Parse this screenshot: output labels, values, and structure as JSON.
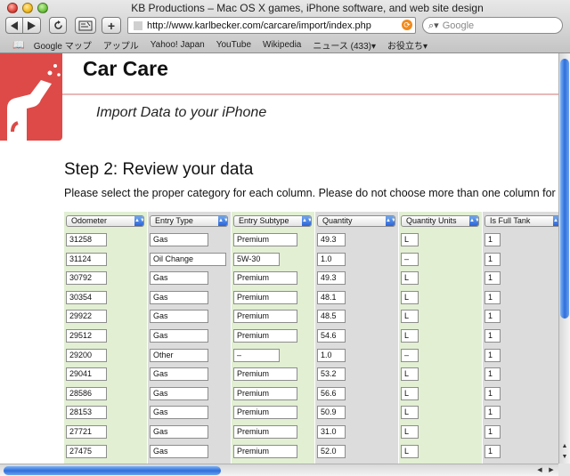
{
  "window": {
    "title": "KB Productions – Mac OS X games, iPhone software, and web site design"
  },
  "toolbar": {
    "back_icon": "back-arrow-icon",
    "forward_icon": "forward-arrow-icon",
    "reload_label": "c",
    "add_bookmark_label": "+",
    "url": "http://www.karlbecker.com/carcare/import/index.php",
    "search_placeholder": "Google"
  },
  "bookmarks": {
    "items": [
      "Google マップ",
      "アップル",
      "Yahoo! Japan",
      "YouTube",
      "Wikipedia",
      "ニュース (433)▾",
      "お役立ち▾"
    ]
  },
  "page": {
    "app_title": "Car Care",
    "app_subtitle": "Import Data to your iPhone",
    "step_title": "Step 2: Review your data",
    "instructions": "Please select the proper category for each column. Please do not choose more than one column for",
    "logo_color": "#dd4a47"
  },
  "grid": {
    "columns": [
      "Odometer",
      "Entry Type",
      "Entry Subtype",
      "Quantity",
      "Quantity Units",
      "Is Full Tank"
    ],
    "rows": [
      [
        "31258",
        "Gas",
        "Premium",
        "49.3",
        "L",
        "1"
      ],
      [
        "31124",
        "Oil Change",
        "5W-30",
        "1.0",
        "–",
        "1"
      ],
      [
        "30792",
        "Gas",
        "Premium",
        "49.3",
        "L",
        "1"
      ],
      [
        "30354",
        "Gas",
        "Premium",
        "48.1",
        "L",
        "1"
      ],
      [
        "29922",
        "Gas",
        "Premium",
        "48.5",
        "L",
        "1"
      ],
      [
        "29512",
        "Gas",
        "Premium",
        "54.6",
        "L",
        "1"
      ],
      [
        "29200",
        "Other",
        "–",
        "1.0",
        "–",
        "1"
      ],
      [
        "29041",
        "Gas",
        "Premium",
        "53.2",
        "L",
        "1"
      ],
      [
        "28586",
        "Gas",
        "Premium",
        "56.6",
        "L",
        "1"
      ],
      [
        "28153",
        "Gas",
        "Premium",
        "50.9",
        "L",
        "1"
      ],
      [
        "27721",
        "Gas",
        "Premium",
        "31.0",
        "L",
        "1"
      ],
      [
        "27475",
        "Gas",
        "Premium",
        "52.0",
        "L",
        "1"
      ]
    ]
  }
}
